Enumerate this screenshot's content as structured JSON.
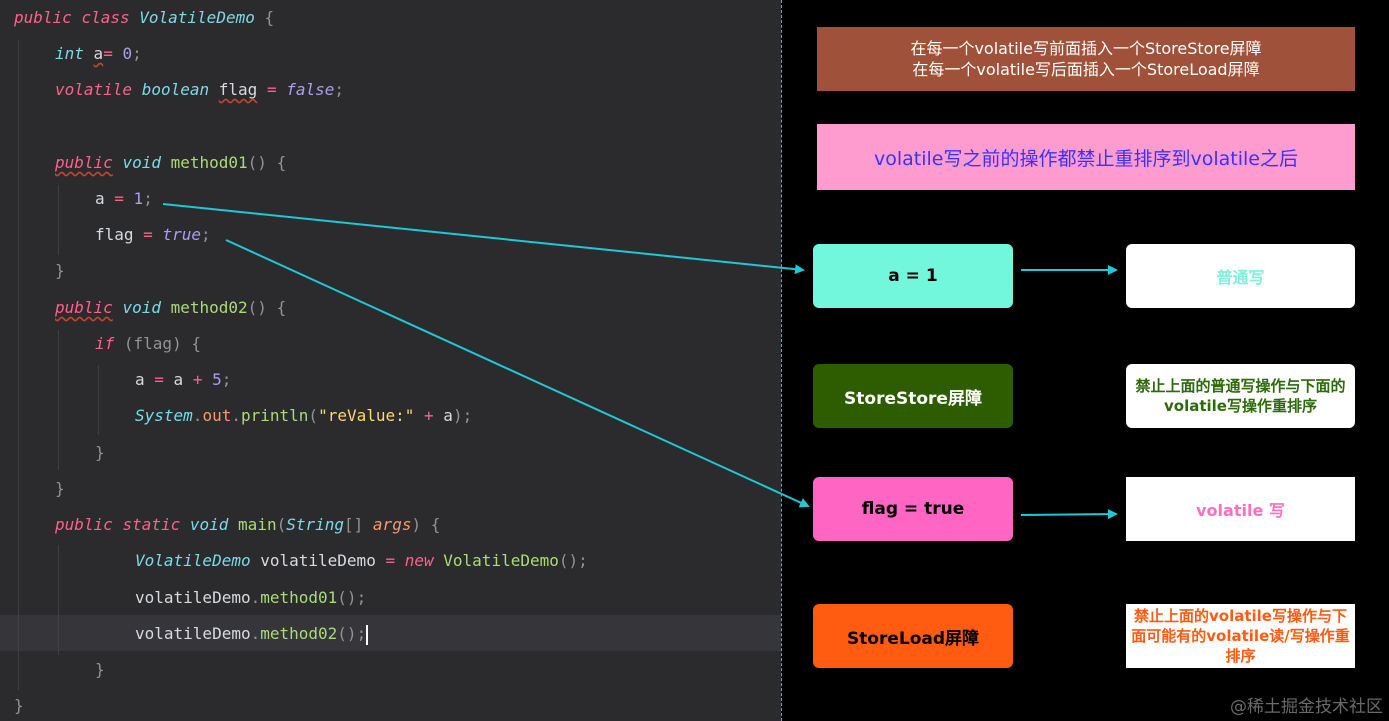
{
  "code": {
    "line1": {
      "kw1": "public",
      "kw2": "class",
      "name": "VolatileDemo",
      "brace": " {"
    },
    "line2": {
      "type": "int",
      "var": "a",
      "op": "=",
      "val": " 0",
      "semi": ";"
    },
    "line3": {
      "kw": "volatile",
      "type": "boolean",
      "var": "flag",
      "op": " = ",
      "val": "false",
      "semi": ";"
    },
    "line5": {
      "kw": "public",
      "type": "void",
      "fn": "method01",
      "rest": "() {"
    },
    "line6": {
      "var": "a",
      "op": " = ",
      "val": "1",
      "semi": ";"
    },
    "line7": {
      "var": "flag",
      "op": " = ",
      "val": "true",
      "semi": ";"
    },
    "line8": {
      "brace": "}"
    },
    "line9": {
      "kw": "public",
      "type": "void",
      "fn": "method02",
      "rest": "() {"
    },
    "line10": {
      "kw": "if",
      "rest": " (flag) {"
    },
    "line11": {
      "var": "a",
      "op1": " = ",
      "var2": "a",
      "op2": " + ",
      "val": "5",
      "semi": ";"
    },
    "line12": {
      "cls": "System",
      "dot1": ".",
      "field": "out",
      "dot2": ".",
      "fn": "println",
      "p1": "(",
      "str": "\"reValue:\"",
      "op": " + ",
      "var": "a",
      "p2": ");"
    },
    "line13": {
      "brace": "}"
    },
    "line14": {
      "brace": "}"
    },
    "line15": {
      "kw1": "public",
      "kw2": "static",
      "type": "void",
      "fn": "main",
      "p1": "(",
      "cls": "String",
      "arr": "[] ",
      "arg": "args",
      "p2": ") {"
    },
    "line16": {
      "cls": "VolatileDemo",
      "var": " volatileDemo",
      "op": " = ",
      "kw": "new",
      "ctor": " VolatileDemo",
      "rest": "();"
    },
    "line17": {
      "var": "volatileDemo",
      "dot": ".",
      "fn": "method01",
      "rest": "();"
    },
    "line18": {
      "var": "volatileDemo",
      "dot": ".",
      "fn": "method02",
      "rest": "();"
    },
    "line19": {
      "brace": "}"
    },
    "line20": {
      "brace": "}"
    }
  },
  "diagram": {
    "header_line1": "在每一个volatile写前面插入一个StoreStore屏障",
    "header_line2": "在每一个volatile写后面插入一个StoreLoad屏障",
    "rule": "volatile写之前的操作都禁止重排序到volatile之后",
    "ops": [
      {
        "label": "a = 1",
        "color": "#72f7dd",
        "text_color": "#000000",
        "note": "普通写",
        "note_color": "#7ff0da"
      },
      {
        "label": "StoreStore屏障",
        "color": "#2d5d00",
        "text_color": "#ffffff",
        "note": "禁止上面的普通写操作与下面的volatile写操作重排序",
        "note_color": "#2d6a0a"
      },
      {
        "label": "flag = true",
        "color": "#ff66c4",
        "text_color": "#000000",
        "note": "volatile 写",
        "note_color": "#ff6fbf"
      },
      {
        "label": "StoreLoad屏障",
        "color": "#ff5b11",
        "text_color": "#000000",
        "note": "禁止上面的volatile写操作与下面可能有的volatile读/写操作重排序",
        "note_color": "#ff5b11"
      }
    ],
    "colors": {
      "header_bg": "#a0513a",
      "rule_bg": "#ff9ccf",
      "rule_text": "#3b31ff",
      "arrow": "#1ec8d6"
    },
    "watermark": "@稀土掘金技术社区"
  }
}
